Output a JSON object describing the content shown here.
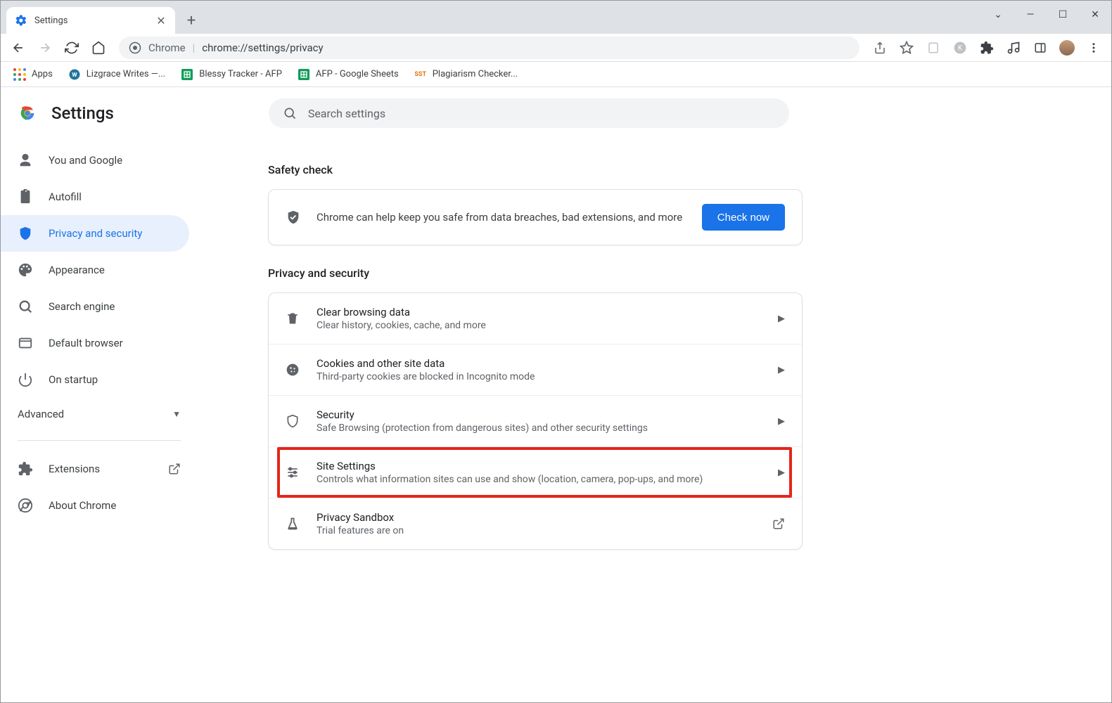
{
  "tab": {
    "title": "Settings"
  },
  "omnibox": {
    "label": "Chrome",
    "url": "chrome://settings/privacy"
  },
  "bookmarks": [
    {
      "label": "Apps"
    },
    {
      "label": "Lizgrace Writes —..."
    },
    {
      "label": "Blessy Tracker - AFP"
    },
    {
      "label": "AFP - Google Sheets"
    },
    {
      "label": "Plagiarism Checker..."
    }
  ],
  "page": {
    "title": "Settings",
    "search_placeholder": "Search settings"
  },
  "nav": {
    "items": [
      {
        "label": "You and Google"
      },
      {
        "label": "Autofill"
      },
      {
        "label": "Privacy and security"
      },
      {
        "label": "Appearance"
      },
      {
        "label": "Search engine"
      },
      {
        "label": "Default browser"
      },
      {
        "label": "On startup"
      }
    ],
    "advanced": "Advanced",
    "extensions": "Extensions",
    "about": "About Chrome"
  },
  "sections": {
    "safety_title": "Safety check",
    "safety_text": "Chrome can help keep you safe from data breaches, bad extensions, and more",
    "check_now": "Check now",
    "privacy_title": "Privacy and security",
    "rows": [
      {
        "title": "Clear browsing data",
        "sub": "Clear history, cookies, cache, and more"
      },
      {
        "title": "Cookies and other site data",
        "sub": "Third-party cookies are blocked in Incognito mode"
      },
      {
        "title": "Security",
        "sub": "Safe Browsing (protection from dangerous sites) and other security settings"
      },
      {
        "title": "Site Settings",
        "sub": "Controls what information sites can use and show (location, camera, pop-ups, and more)"
      },
      {
        "title": "Privacy Sandbox",
        "sub": "Trial features are on"
      }
    ]
  }
}
